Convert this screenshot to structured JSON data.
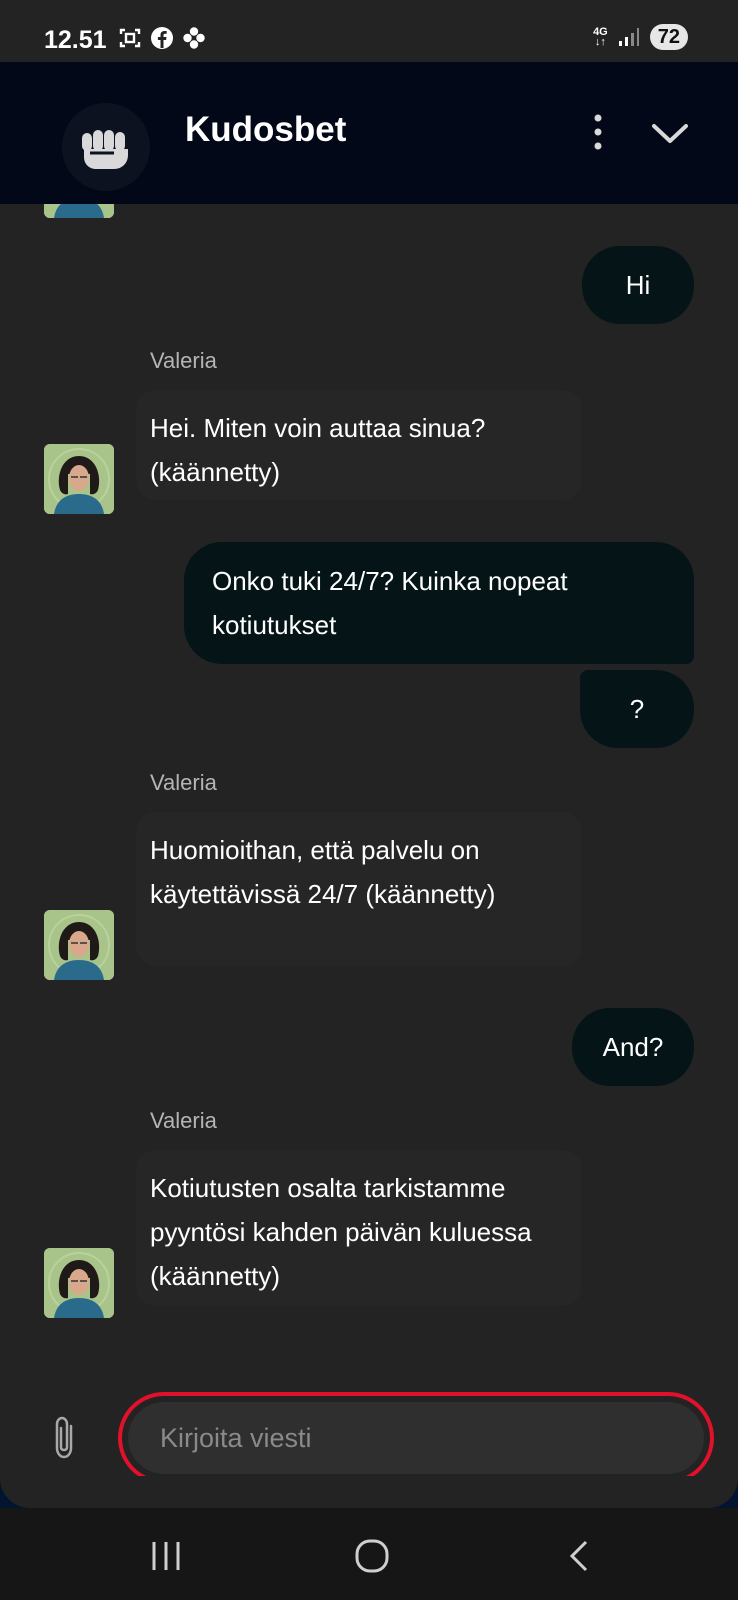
{
  "status_bar": {
    "time": "12.51",
    "network": "4G",
    "battery": "72"
  },
  "header": {
    "title": "Kudosbet",
    "logo_icon": "fist-icon",
    "menu_icon": "kebab-icon",
    "collapse_icon": "chevron-down-icon"
  },
  "messages": [
    {
      "side": "out",
      "text": "Hi"
    },
    {
      "side": "in",
      "sender": "Valeria",
      "text": "Hei. Miten voin auttaa sinua? (käännetty)"
    },
    {
      "side": "out",
      "text": "Onko tuki 24/7? Kuinka nopeat kotiutukset"
    },
    {
      "side": "out",
      "text": "?"
    },
    {
      "side": "in",
      "sender": "Valeria",
      "text": "Huomioithan, että palvelu on käytettävissä 24/7 (käännetty)"
    },
    {
      "side": "out",
      "text": "And?"
    },
    {
      "side": "in",
      "sender": "Valeria",
      "text": "Kotiutusten osalta tarkistamme pyyntösi kahden päivän kuluessa (käännetty)"
    }
  ],
  "composer": {
    "placeholder": "Kirjoita viesti",
    "attach_icon": "paperclip-icon"
  },
  "colors": {
    "header_bg": "#030818",
    "outgoing_bubble": "#041417",
    "incoming_bubble": "#262626",
    "input_highlight": "#e0112b"
  }
}
